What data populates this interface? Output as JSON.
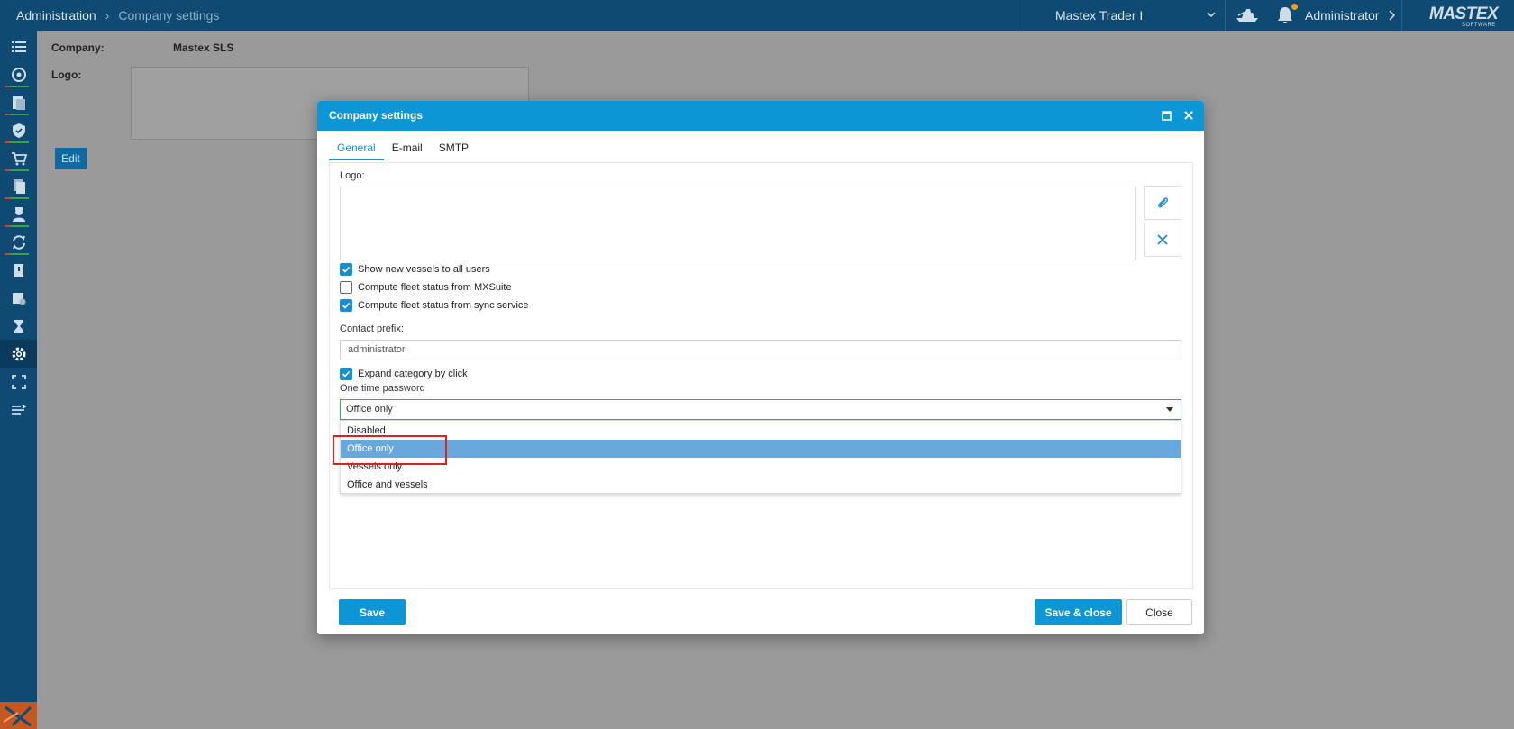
{
  "topbar": {
    "breadcrumb_root": "Administration",
    "breadcrumb_current": "Company settings",
    "vessel_selected": "Mastex Trader I",
    "user_name": "Administrator",
    "brand_name": "MASTEX",
    "brand_sub": "SOFTWARE",
    "notification_dot_color": "#f0a020"
  },
  "sidebar": {
    "items": [
      {
        "icon": "list-icon"
      },
      {
        "icon": "dashboard-icon"
      },
      {
        "icon": "documents-icon"
      },
      {
        "icon": "shield-icon"
      },
      {
        "icon": "cart-icon"
      },
      {
        "icon": "files-icon"
      },
      {
        "icon": "crew-icon"
      },
      {
        "icon": "sync-icon"
      },
      {
        "icon": "bookmark-icon"
      },
      {
        "icon": "reports-icon"
      },
      {
        "icon": "hourglass-icon"
      },
      {
        "icon": "gear-icon",
        "active": true
      },
      {
        "icon": "fullscreen-icon"
      },
      {
        "icon": "collapse-icon"
      }
    ]
  },
  "background": {
    "company_label": "Company:",
    "company_value": "Mastex SLS",
    "logo_label": "Logo:",
    "edit_label": "Edit"
  },
  "modal": {
    "title": "Company settings",
    "tabs": [
      {
        "label": "General",
        "active": true
      },
      {
        "label": "E-mail"
      },
      {
        "label": "SMTP"
      }
    ],
    "logo_label": "Logo:",
    "checkboxes": [
      {
        "label": "Show new vessels to all users",
        "checked": true
      },
      {
        "label": "Compute fleet status from MXSuite",
        "checked": false
      },
      {
        "label": "Compute fleet status from sync service",
        "checked": true
      }
    ],
    "contact_prefix_label": "Contact prefix:",
    "contact_prefix_value": "administrator",
    "expand_category": {
      "label": "Expand category by click",
      "checked": true
    },
    "otp_label": "One time password",
    "otp_value": "Office only",
    "otp_options": [
      "Disabled",
      "Office only",
      "Vessels only",
      "Office and vessels"
    ],
    "otp_selected_index": 1,
    "save_label": "Save",
    "save_close_label": "Save & close",
    "close_label": "Close",
    "accent_color": "#0d96d6"
  }
}
